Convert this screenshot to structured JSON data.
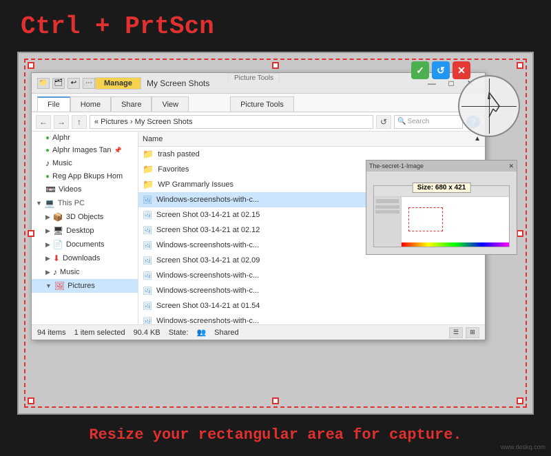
{
  "heading": "Ctrl + PrtScn",
  "footer": "Resize your rectangular area for capture.",
  "watermark": "www.deskq.com",
  "toolbar_buttons": {
    "check": "✓",
    "refresh": "↺",
    "cancel": "✕"
  },
  "explorer": {
    "title": "My Screen Shots",
    "manage_label": "Manage",
    "picture_tools_label": "Picture Tools",
    "tabs": [
      "File",
      "Home",
      "Share",
      "View",
      "Picture Tools"
    ],
    "breadcrumb": "« Pictures › My Screen Shots",
    "search_placeholder": "Search",
    "nav_buttons": [
      "←",
      "→",
      "↑"
    ],
    "window_controls": [
      "—",
      "□",
      "✕"
    ],
    "sidebar_items": [
      {
        "label": "Alphr",
        "icon": "●",
        "indent": 1,
        "type": "quick"
      },
      {
        "label": "Alphr Images Tan",
        "icon": "●",
        "indent": 1,
        "type": "quick"
      },
      {
        "label": "Music",
        "icon": "♪",
        "indent": 1,
        "type": "quick"
      },
      {
        "label": "Reg App Bkups Hom",
        "icon": "●",
        "indent": 1,
        "type": "quick"
      },
      {
        "label": "Videos",
        "icon": "🎬",
        "indent": 1,
        "type": "quick"
      },
      {
        "label": "This PC",
        "icon": "💻",
        "indent": 0,
        "type": "section"
      },
      {
        "label": "3D Objects",
        "icon": "📦",
        "indent": 1,
        "type": "item"
      },
      {
        "label": "Desktop",
        "icon": "🖥",
        "indent": 1,
        "type": "item"
      },
      {
        "label": "Documents",
        "icon": "📄",
        "indent": 1,
        "type": "item"
      },
      {
        "label": "Downloads",
        "icon": "⬇",
        "indent": 1,
        "type": "item"
      },
      {
        "label": "Music",
        "icon": "♪",
        "indent": 1,
        "type": "item"
      },
      {
        "label": "Pictures",
        "icon": "🖼",
        "indent": 1,
        "type": "item",
        "selected": true
      }
    ],
    "files": [
      {
        "name": "trash pasted",
        "type": "folder"
      },
      {
        "name": "Favorites",
        "type": "folder"
      },
      {
        "name": "WP Grammarly Issues",
        "type": "folder"
      },
      {
        "name": "Windows-screenshots-with-c...",
        "type": "image",
        "selected": true
      },
      {
        "name": "Screen Shot 03-14-21 at 02.15",
        "type": "image"
      },
      {
        "name": "Screen Shot 03-14-21 at 02.12",
        "type": "image"
      },
      {
        "name": "Windows-screenshots-with-c...",
        "type": "image"
      },
      {
        "name": "Screen Shot 03-14-21 at 02.09",
        "type": "image"
      },
      {
        "name": "Windows-screenshots-with-c...",
        "type": "image"
      },
      {
        "name": "Windows-screenshots-with-c...",
        "type": "image"
      },
      {
        "name": "Screen Shot 03-14-21 at 01.54",
        "type": "image"
      },
      {
        "name": "Windows-screenshots-with-c...",
        "type": "image"
      }
    ],
    "file_column_header": "Name",
    "status": {
      "count": "94 items",
      "selected": "1 item selected",
      "size": "90.4 KB",
      "state": "State:",
      "shared": "Shared"
    }
  },
  "thumbnail": {
    "title": "The-secret-1-Image",
    "size_label": "Size: 680 x 421"
  },
  "crosshair": {
    "visible": true
  }
}
